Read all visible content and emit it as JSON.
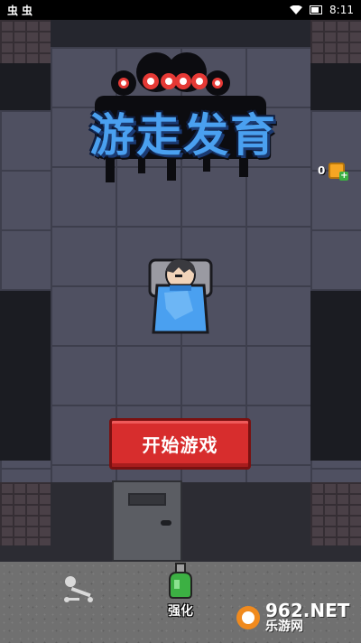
{
  "status_bar": {
    "left_icons": [
      "bug-icon",
      "bug-icon"
    ],
    "left_glyphs": [
      "虫",
      "虫"
    ],
    "time": "8:11"
  },
  "game": {
    "title": "游走发育",
    "coin_count": "0",
    "start_button_label": "开始游戏",
    "upgrade_label": "强化"
  },
  "watermark": {
    "brand": "962.NET",
    "sub": "乐游网"
  },
  "colors": {
    "button": "#d72d2d",
    "title": "#4aa0f0",
    "coin": "#f5a623",
    "potion": "#3cb043"
  }
}
